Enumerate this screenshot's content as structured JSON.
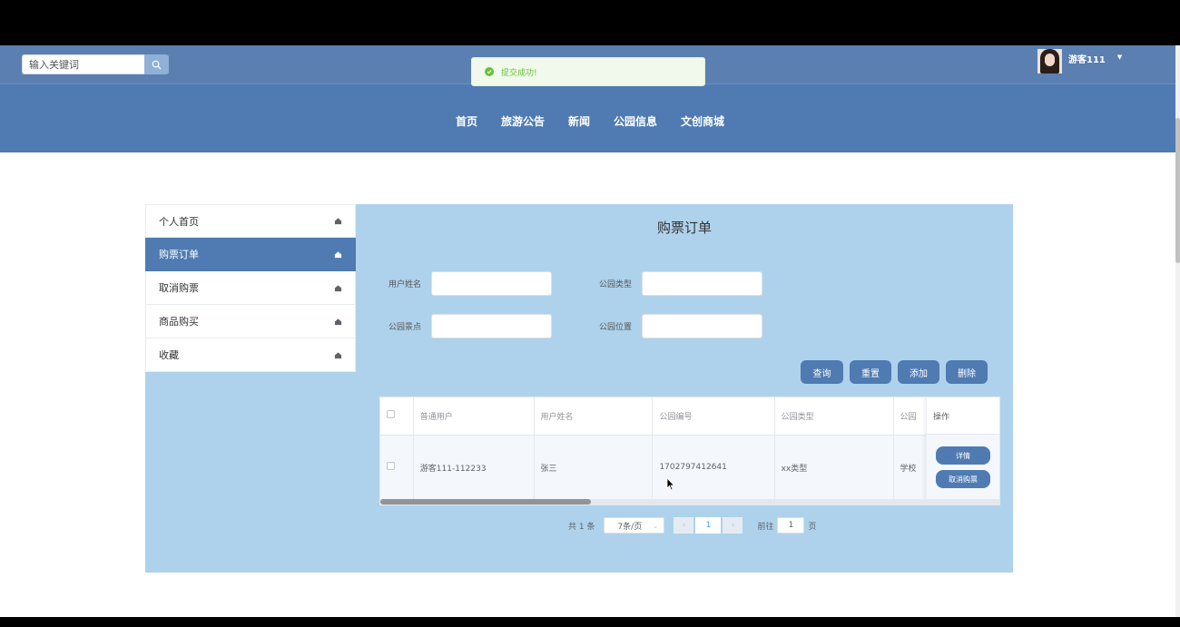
{
  "search": {
    "placeholder": "输入关键词"
  },
  "toast": {
    "text": "提交成功!"
  },
  "user": {
    "name": "游客111"
  },
  "nav": [
    "首页",
    "旅游公告",
    "新闻",
    "公园信息",
    "文创商城"
  ],
  "sidebar": [
    {
      "label": "个人首页"
    },
    {
      "label": "购票订单"
    },
    {
      "label": "取消购票"
    },
    {
      "label": "商品购买"
    },
    {
      "label": "收藏"
    }
  ],
  "panel": {
    "title": "购票订单"
  },
  "form": {
    "user_name_label": "用户姓名",
    "park_type_label": "公园类型",
    "park_spot_label": "公园景点",
    "park_location_label": "公园位置"
  },
  "buttons": {
    "search": "查询",
    "reset": "重置",
    "add": "添加",
    "delete": "删除"
  },
  "table": {
    "headers": [
      "普通用户",
      "用户姓名",
      "公园编号",
      "公园类型",
      "公园"
    ],
    "ops_header": "操作",
    "rows": [
      {
        "user": "游客111-112233",
        "name": "张三",
        "park_no": "1702797412641",
        "park_type": "xx类型",
        "park_name": "学校"
      }
    ],
    "ops": {
      "detail": "详情",
      "cancel": "取消购票"
    }
  },
  "pagination": {
    "total": "共 1 条",
    "page_size": "7条/页",
    "current": "1",
    "goto_label": "前往",
    "goto_value": "1",
    "page_suffix": "页"
  },
  "colors": {
    "primary": "#4f7bb2",
    "panel_bg": "#aed2eb",
    "success": "#67c23a"
  }
}
